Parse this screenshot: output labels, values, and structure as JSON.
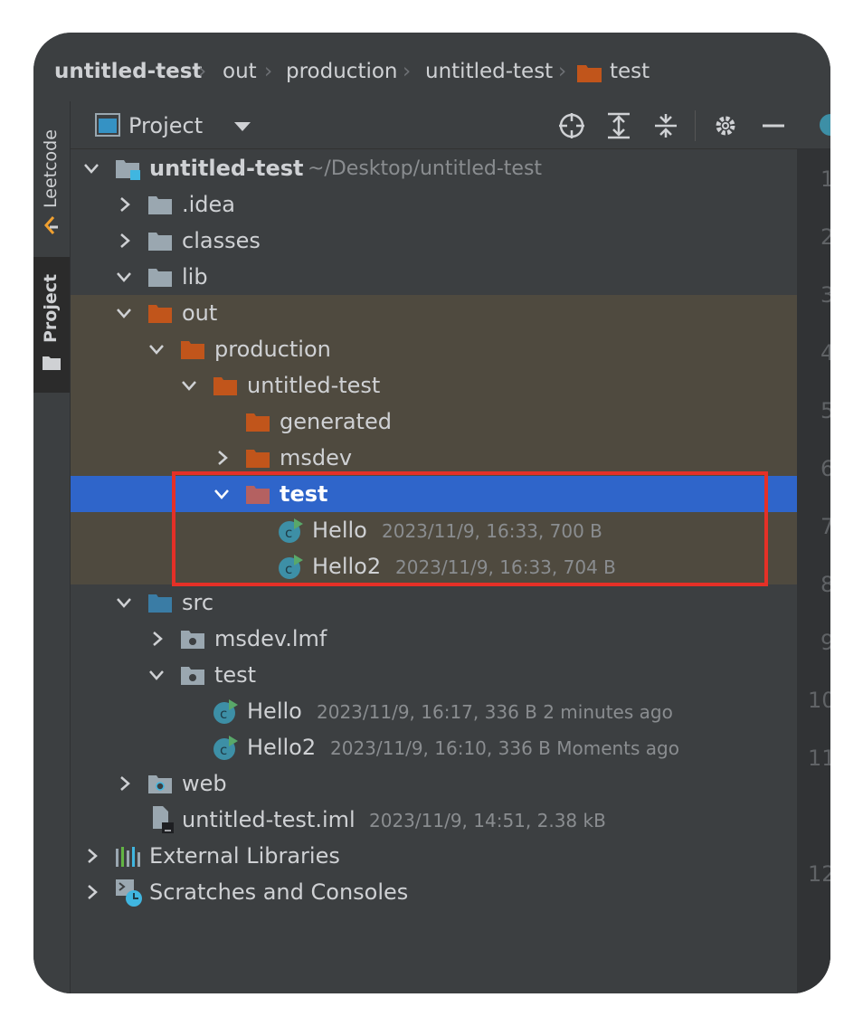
{
  "breadcrumb": {
    "items": [
      "untitled-test",
      "out",
      "production",
      "untitled-test",
      "test"
    ]
  },
  "sidebar": {
    "tabs": [
      {
        "label": "Leetcode",
        "active": false
      },
      {
        "label": "Project",
        "active": true
      }
    ]
  },
  "panel": {
    "title": "Project",
    "toolbar_icons": [
      "select-opened-file-icon",
      "expand-all-icon",
      "collapse-all-icon",
      "gear-icon",
      "hide-icon"
    ]
  },
  "tree": {
    "root": {
      "name": "untitled-test",
      "path": "~/Desktop/untitled-test"
    },
    "rows": [
      {
        "name": ".idea"
      },
      {
        "name": "classes"
      },
      {
        "name": "lib"
      },
      {
        "name": "out"
      },
      {
        "name": "production"
      },
      {
        "name": "untitled-test"
      },
      {
        "name": "generated"
      },
      {
        "name": "msdev"
      },
      {
        "name": "test"
      },
      {
        "name": "Hello",
        "meta": "2023/11/9, 16:33, 700 B"
      },
      {
        "name": "Hello2",
        "meta": "2023/11/9, 16:33, 704 B"
      },
      {
        "name": "src"
      },
      {
        "name": "msdev.lmf"
      },
      {
        "name": "test"
      },
      {
        "name": "Hello",
        "meta": "2023/11/9, 16:17, 336 B 2 minutes ago"
      },
      {
        "name": "Hello2",
        "meta": "2023/11/9, 16:10, 336 B Moments ago"
      },
      {
        "name": "web"
      },
      {
        "name": "untitled-test.iml",
        "meta": "2023/11/9, 14:51, 2.38 kB"
      },
      {
        "name": "External Libraries"
      },
      {
        "name": "Scratches and Consoles"
      }
    ]
  },
  "gutter": {
    "line_numbers": [
      "1",
      "2",
      "3",
      "4",
      "5",
      "6",
      "7",
      "8",
      "9",
      "10",
      "11",
      "12"
    ]
  },
  "colors": {
    "selection": "#2f65ca",
    "highlight_excluded": "#4f4a3f",
    "excluded_folder": "#c1551b",
    "source_folder": "#3a7ca5",
    "annotation_box": "#e53027"
  }
}
